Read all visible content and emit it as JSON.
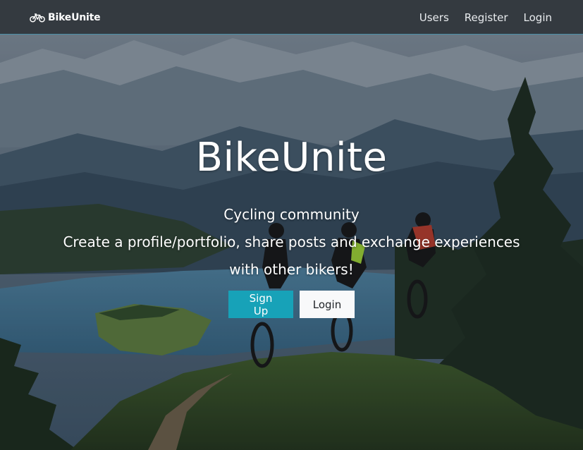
{
  "navbar": {
    "brand": "BikeUnite",
    "brand_icon": "bicycle-icon",
    "links": [
      {
        "label": "Users"
      },
      {
        "label": "Register"
      },
      {
        "label": "Login"
      }
    ]
  },
  "hero": {
    "title": "BikeUnite",
    "subtitle_lines": [
      "Cycling community",
      "Create a profile/portfolio, share posts and exchange experiences",
      "with other bikers!"
    ],
    "buttons": {
      "signup_label": "Sign Up",
      "login_label": "Login"
    }
  },
  "colors": {
    "navbar_bg": "#343a40",
    "primary": "#17a2b8",
    "light": "#f8f9fa"
  }
}
